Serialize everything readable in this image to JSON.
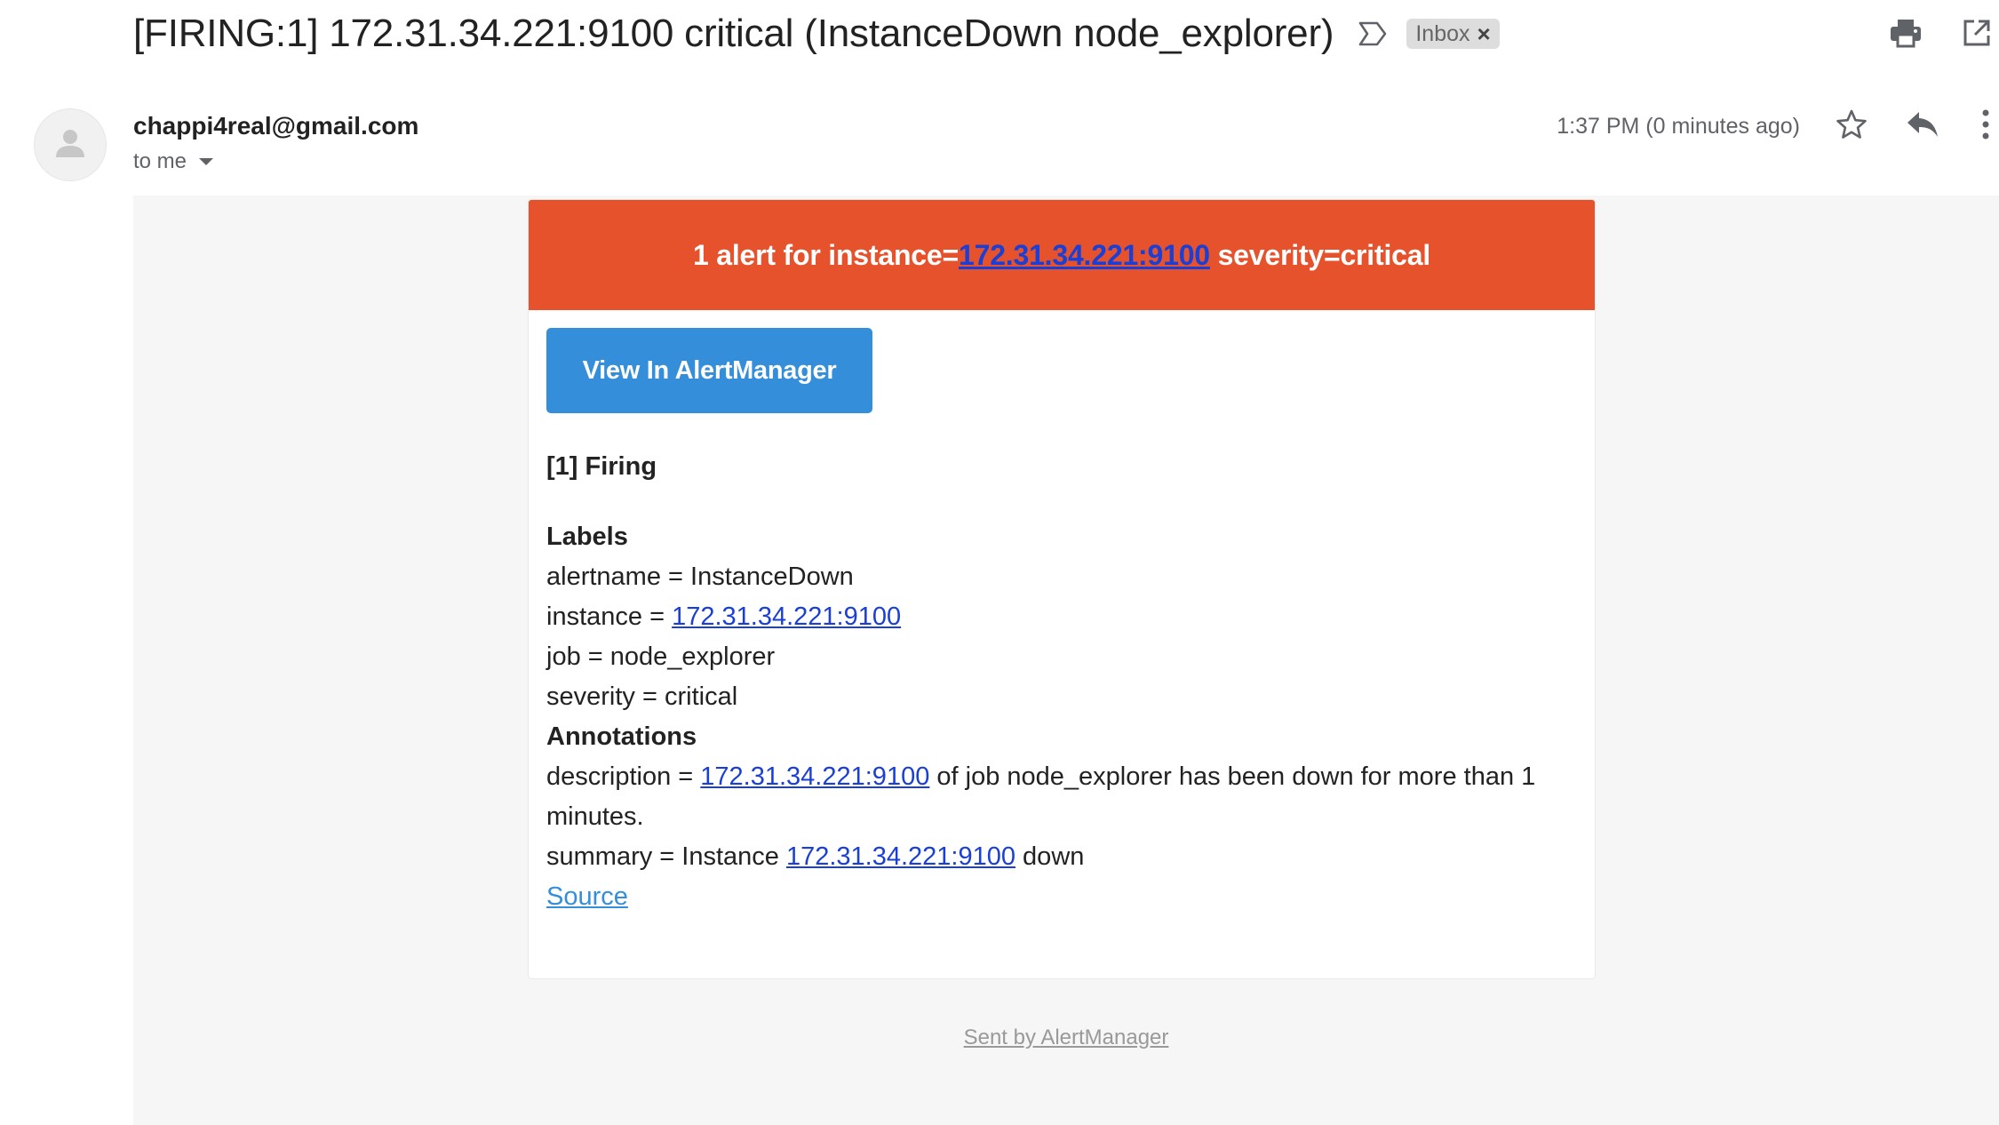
{
  "subject": {
    "text": "[FIRING:1] 172.31.34.221:9100 critical (InstanceDown node_explorer)",
    "label_chip": "Inbox",
    "label_close": "×"
  },
  "top_actions": {
    "print_icon": "printer-icon",
    "popout_icon": "open-in-new-window-icon"
  },
  "sender": {
    "email": "chappi4real@gmail.com",
    "recipient": "to me",
    "timestamp": "1:37 PM (0 minutes ago)"
  },
  "alert": {
    "header_prefix": "1 alert for instance=",
    "header_instance": "172.31.34.221:9100",
    "header_suffix": " severity=critical",
    "header_color": "#e6522c",
    "button_label": "View In AlertManager",
    "button_color": "#348eda",
    "firing_title": "[1] Firing",
    "labels_title": "Labels",
    "labels": {
      "alertname": "alertname = InstanceDown",
      "instance_prefix": "instance = ",
      "instance_value": "172.31.34.221:9100",
      "job": "job = node_explorer",
      "severity": "severity = critical"
    },
    "annotations_title": "Annotations",
    "annotations": {
      "description_prefix": "description = ",
      "description_link": "172.31.34.221:9100",
      "description_suffix": " of job node_explorer has been down for more than 1 minutes.",
      "summary_prefix": "summary = Instance ",
      "summary_link": "172.31.34.221:9100",
      "summary_suffix": " down"
    },
    "source_link": "Source"
  },
  "footer": {
    "sent_by": "Sent by AlertManager"
  }
}
